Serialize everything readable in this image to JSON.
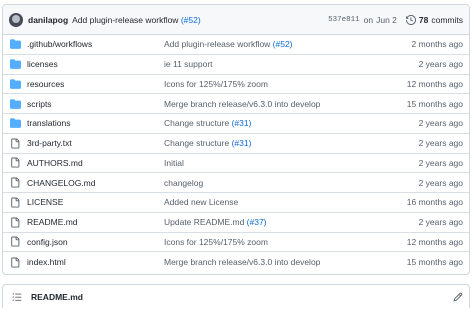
{
  "commit": {
    "author": "danilapog",
    "message": "Add plugin-release workflow",
    "pr": "(#52)",
    "sha": "537e811",
    "on": "on",
    "date": "Jun 2",
    "history_count": "78",
    "history_label": "commits"
  },
  "files": [
    {
      "type": "dir",
      "name": ".github/workflows",
      "msg": "Add plugin-release workflow ",
      "pr": "(#52)",
      "date": "2 months ago"
    },
    {
      "type": "dir",
      "name": "licenses",
      "msg": "ie 11 support",
      "pr": "",
      "date": "2 years ago"
    },
    {
      "type": "dir",
      "name": "resources",
      "msg": "Icons for 125%/175% zoom",
      "pr": "",
      "date": "12 months ago"
    },
    {
      "type": "dir",
      "name": "scripts",
      "msg": "Merge branch release/v6.3.0 into develop",
      "pr": "",
      "date": "15 months ago"
    },
    {
      "type": "dir",
      "name": "translations",
      "msg": "Change structure ",
      "pr": "(#31)",
      "date": "2 years ago"
    },
    {
      "type": "file",
      "name": "3rd-party.txt",
      "msg": "Change structure ",
      "pr": "(#31)",
      "date": "2 years ago"
    },
    {
      "type": "file",
      "name": "AUTHORS.md",
      "msg": "Initial",
      "pr": "",
      "date": "2 years ago"
    },
    {
      "type": "file",
      "name": "CHANGELOG.md",
      "msg": "changelog",
      "pr": "",
      "date": "2 years ago"
    },
    {
      "type": "file",
      "name": "LICENSE",
      "msg": "Added new License",
      "pr": "",
      "date": "16 months ago"
    },
    {
      "type": "file",
      "name": "README.md",
      "msg": "Update README.md ",
      "pr": "(#37)",
      "date": "2 years ago"
    },
    {
      "type": "file",
      "name": "config.json",
      "msg": "Icons for 125%/175% zoom",
      "pr": "",
      "date": "12 months ago"
    },
    {
      "type": "file",
      "name": "index.html",
      "msg": "Merge branch release/v6.3.0 into develop",
      "pr": "",
      "date": "15 months ago"
    }
  ],
  "readme": {
    "title": "README.md"
  },
  "colors": {
    "folder": "#54aeff",
    "link": "#0969da",
    "muted": "#57606a"
  },
  "icons": {
    "dir": "folder-icon",
    "file": "file-icon",
    "history": "history-icon",
    "list": "list-unordered-icon",
    "edit": "pencil-icon"
  }
}
